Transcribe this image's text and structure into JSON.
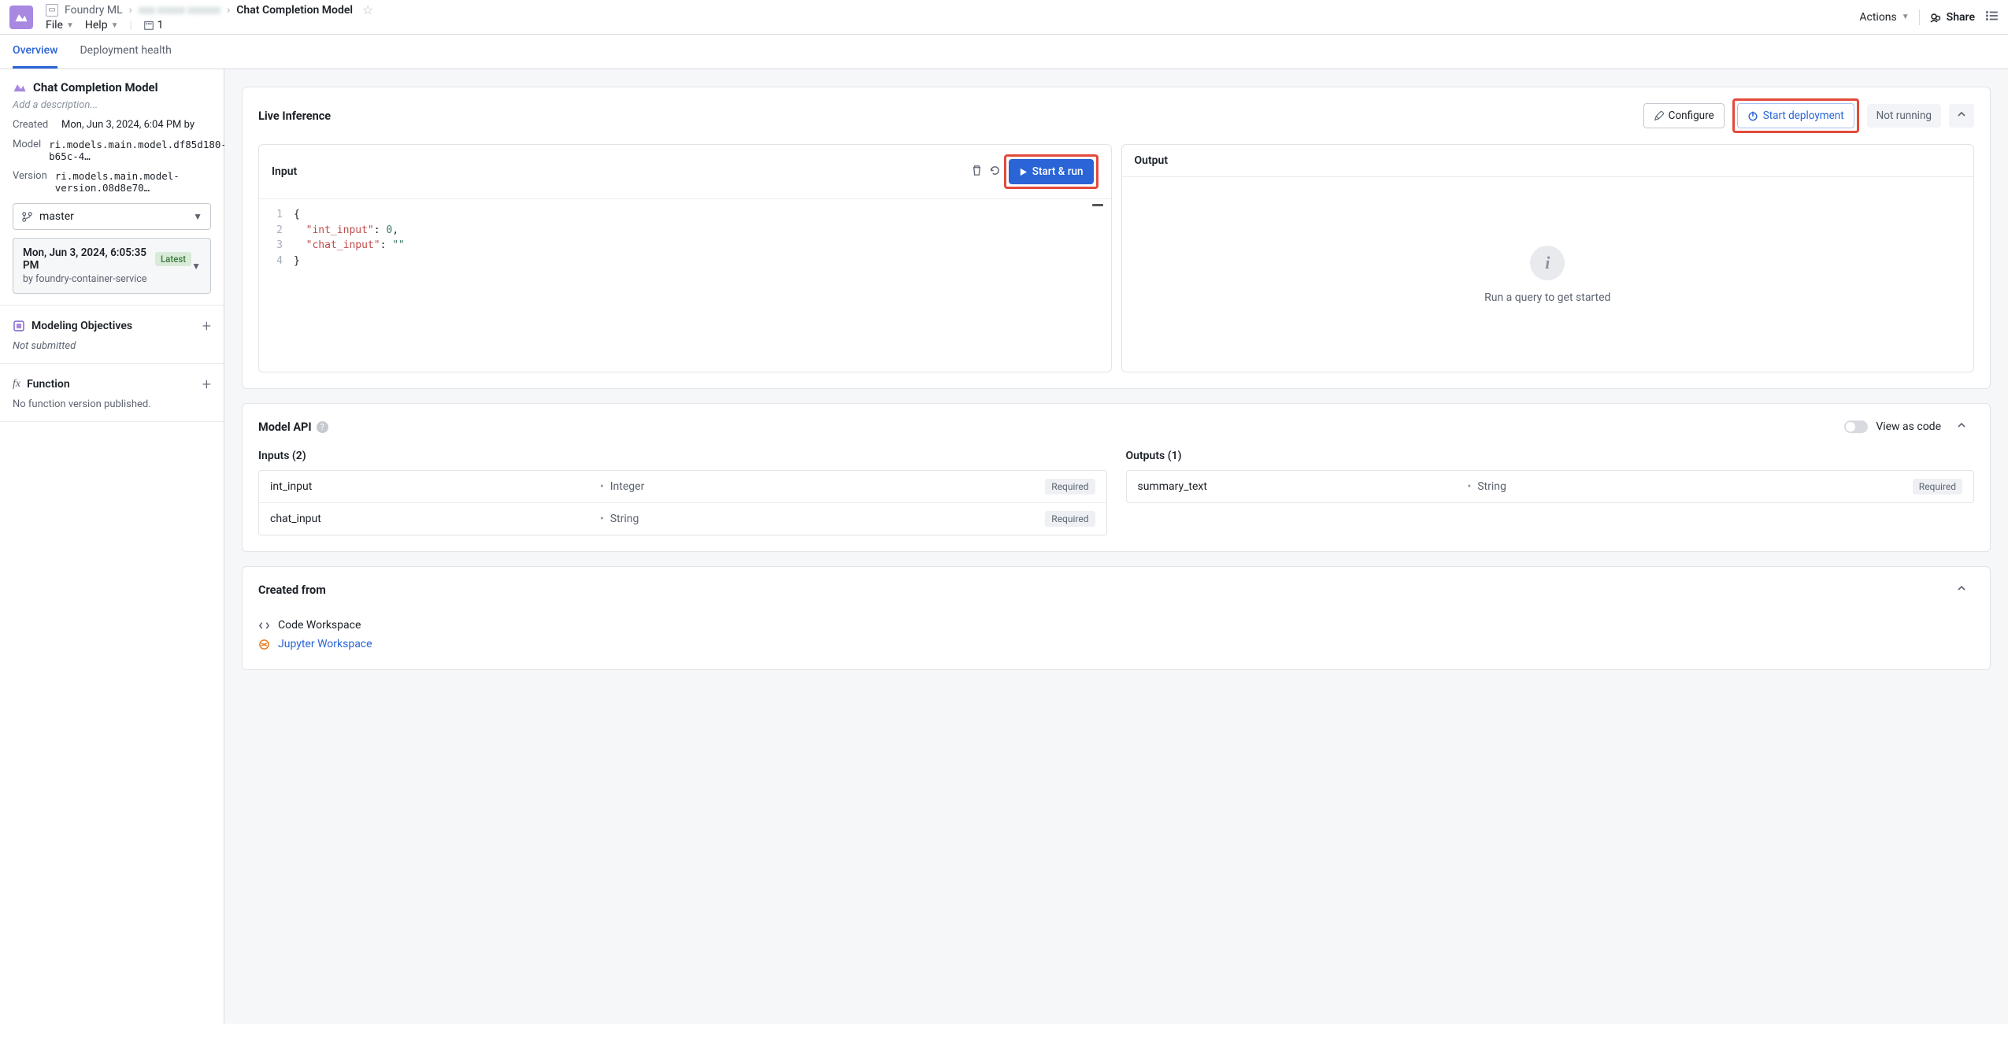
{
  "header": {
    "breadcrumb_root": "Foundry ML",
    "breadcrumb_current": "Chat Completion Model",
    "actions_label": "Actions",
    "share_label": "Share",
    "file_label": "File",
    "help_label": "Help",
    "resource_count": "1"
  },
  "tabs": {
    "overview": "Overview",
    "deployment_health": "Deployment health"
  },
  "sidebar": {
    "title": "Chat Completion Model",
    "description_placeholder": "Add a description...",
    "created_label": "Created",
    "created_value": "Mon, Jun 3, 2024, 6:04 PM by",
    "model_label": "Model",
    "model_value": "ri.models.main.model.df85d180-b65c-4…",
    "version_label": "Version",
    "version_value": "ri.models.main.model-version.08d8e70…",
    "branch": "master",
    "version_box": {
      "timestamp": "Mon, Jun 3, 2024, 6:05:35 PM",
      "badge": "Latest",
      "by": "by foundry-container-service"
    },
    "objectives_title": "Modeling Objectives",
    "objectives_status": "Not submitted",
    "function_title": "Function",
    "function_status": "No function version published."
  },
  "live_inference": {
    "title": "Live Inference",
    "configure": "Configure",
    "start_deployment": "Start deployment",
    "status": "Not running",
    "input_title": "Input",
    "start_run": "Start & run",
    "output_title": "Output",
    "output_empty": "Run a query to get started",
    "code": {
      "line1_key": "\"int_input\"",
      "line1_val": "0",
      "line2_key": "\"chat_input\"",
      "line2_val": "\"\""
    }
  },
  "model_api": {
    "title": "Model API",
    "view_as_code": "View as code",
    "inputs_title": "Inputs (2)",
    "outputs_title": "Outputs (1)",
    "required": "Required",
    "inputs": [
      {
        "name": "int_input",
        "type": "Integer"
      },
      {
        "name": "chat_input",
        "type": "String"
      }
    ],
    "outputs": [
      {
        "name": "summary_text",
        "type": "String"
      }
    ]
  },
  "created_from": {
    "title": "Created from",
    "code_workspace": "Code Workspace",
    "jupyter_workspace": "Jupyter Workspace"
  }
}
